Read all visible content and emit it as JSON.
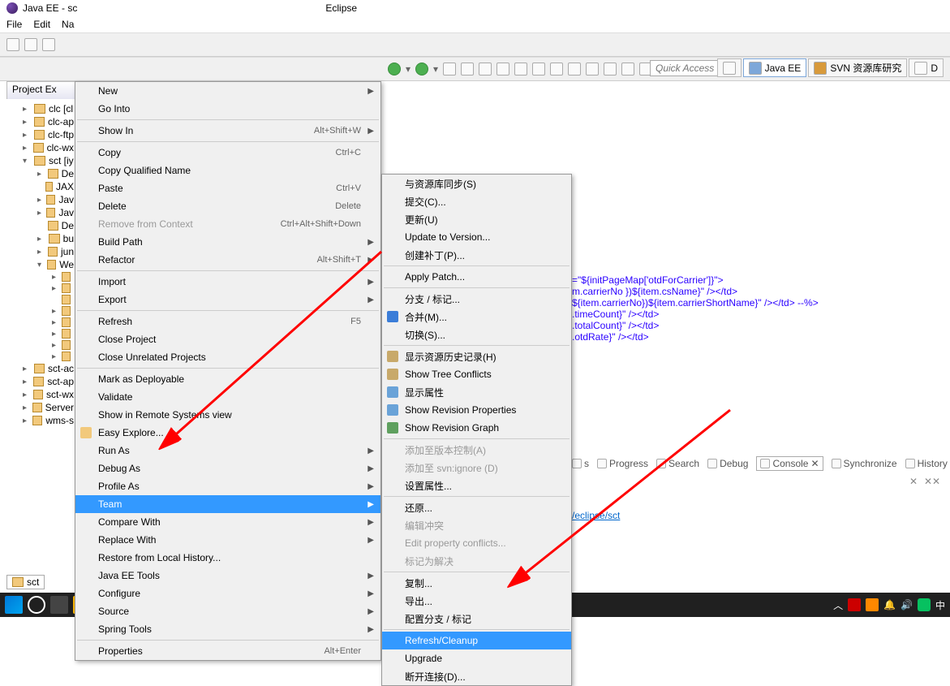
{
  "window_title": "Java EE - sc",
  "partial_end": "Eclipse",
  "menubar": [
    "File",
    "Edit",
    "Na"
  ],
  "quick_access_placeholder": "Quick Access",
  "perspectives": [
    {
      "label": "Java EE",
      "active": true
    },
    {
      "label": "SVN 资源库研究",
      "active": false
    },
    {
      "label": "D",
      "active": false
    }
  ],
  "views": {
    "project_explorer_title": "Project Ex"
  },
  "tree": [
    {
      "label": "clc [cl",
      "level": 1,
      "exp": "▸"
    },
    {
      "label": "clc-ap",
      "level": 1,
      "exp": "▸"
    },
    {
      "label": "clc-ftp",
      "level": 1,
      "exp": "▸"
    },
    {
      "label": "clc-wx",
      "level": 1,
      "exp": "▸"
    },
    {
      "label": "sct [iy",
      "level": 1,
      "exp": "▾",
      "sel": true
    },
    {
      "label": "De",
      "level": 2,
      "exp": "▸"
    },
    {
      "label": "JAX",
      "level": 2,
      "exp": ""
    },
    {
      "label": "Jav",
      "level": 2,
      "exp": "▸"
    },
    {
      "label": "Jav",
      "level": 2,
      "exp": "▸"
    },
    {
      "label": "De",
      "level": 2,
      "exp": ""
    },
    {
      "label": "bu",
      "level": 2,
      "exp": "▸"
    },
    {
      "label": "jun",
      "level": 2,
      "exp": "▸"
    },
    {
      "label": "We",
      "level": 2,
      "exp": "▾"
    },
    {
      "label": "",
      "level": 3,
      "exp": "▸"
    },
    {
      "label": "",
      "level": 3,
      "exp": "▸"
    },
    {
      "label": "",
      "level": 3,
      "exp": ""
    },
    {
      "label": "",
      "level": 3,
      "exp": "▸"
    },
    {
      "label": "",
      "level": 3,
      "exp": "▸"
    },
    {
      "label": "",
      "level": 3,
      "exp": "▸"
    },
    {
      "label": "",
      "level": 3,
      "exp": "▸"
    },
    {
      "label": "",
      "level": 3,
      "exp": "▸"
    },
    {
      "label": "sct-ac",
      "level": 1,
      "exp": "▸"
    },
    {
      "label": "sct-ap",
      "level": 1,
      "exp": "▸"
    },
    {
      "label": "sct-wx",
      "level": 1,
      "exp": "▸"
    },
    {
      "label": "Server",
      "level": 1,
      "exp": "▸"
    },
    {
      "label": "wms-s",
      "level": 1,
      "exp": "▸"
    }
  ],
  "context_menu": [
    {
      "label": "New",
      "arrow": true
    },
    {
      "label": "Go Into"
    },
    {
      "sep": true
    },
    {
      "label": "Show In",
      "shortcut": "Alt+Shift+W",
      "arrow": true
    },
    {
      "sep": true
    },
    {
      "label": "Copy",
      "shortcut": "Ctrl+C"
    },
    {
      "label": "Copy Qualified Name"
    },
    {
      "label": "Paste",
      "shortcut": "Ctrl+V"
    },
    {
      "label": "Delete",
      "shortcut": "Delete"
    },
    {
      "label": "Remove from Context",
      "shortcut": "Ctrl+Alt+Shift+Down",
      "disabled": true
    },
    {
      "label": "Build Path",
      "arrow": true
    },
    {
      "label": "Refactor",
      "shortcut": "Alt+Shift+T",
      "arrow": true
    },
    {
      "sep": true
    },
    {
      "label": "Import",
      "arrow": true
    },
    {
      "label": "Export",
      "arrow": true
    },
    {
      "sep": true
    },
    {
      "label": "Refresh",
      "shortcut": "F5"
    },
    {
      "label": "Close Project"
    },
    {
      "label": "Close Unrelated Projects"
    },
    {
      "sep": true
    },
    {
      "label": "Mark as Deployable"
    },
    {
      "label": "Validate"
    },
    {
      "label": "Show in Remote Systems view"
    },
    {
      "label": "Easy Explore...",
      "icon": "#f2c97c"
    },
    {
      "label": "Run As",
      "arrow": true
    },
    {
      "label": "Debug As",
      "arrow": true
    },
    {
      "label": "Profile As",
      "arrow": true
    },
    {
      "label": "Team",
      "arrow": true,
      "selected": true
    },
    {
      "label": "Compare With",
      "arrow": true
    },
    {
      "label": "Replace With",
      "arrow": true
    },
    {
      "label": "Restore from Local History..."
    },
    {
      "label": "Java EE Tools",
      "arrow": true
    },
    {
      "label": "Configure",
      "arrow": true
    },
    {
      "label": "Source",
      "arrow": true
    },
    {
      "label": "Spring Tools",
      "arrow": true
    },
    {
      "sep": true
    },
    {
      "label": "Properties",
      "shortcut": "Alt+Enter"
    }
  ],
  "team_submenu": [
    {
      "label": "与资源库同步(S)"
    },
    {
      "label": "提交(C)..."
    },
    {
      "label": "更新(U)"
    },
    {
      "label": "Update to Version..."
    },
    {
      "label": "创建补丁(P)..."
    },
    {
      "sep": true
    },
    {
      "label": "Apply Patch..."
    },
    {
      "sep": true
    },
    {
      "label": "分支 / 标记..."
    },
    {
      "label": "合并(M)...",
      "icon": "#3b7dd8"
    },
    {
      "label": "切换(S)..."
    },
    {
      "sep": true
    },
    {
      "label": "显示资源历史记录(H)",
      "icon": "#c8a96a"
    },
    {
      "label": "Show Tree Conflicts",
      "icon": "#c8a96a"
    },
    {
      "label": "显示属性",
      "icon": "#6aa3d8"
    },
    {
      "label": "Show Revision Properties",
      "icon": "#6aa3d8"
    },
    {
      "label": "Show Revision Graph",
      "icon": "#5fa05f"
    },
    {
      "sep": true
    },
    {
      "label": "添加至版本控制(A)",
      "disabled": true
    },
    {
      "label": "添加至 svn:ignore (D)",
      "disabled": true
    },
    {
      "label": "设置属性..."
    },
    {
      "sep": true
    },
    {
      "label": "还原..."
    },
    {
      "label": "编辑冲突",
      "disabled": true
    },
    {
      "label": "Edit property conflicts...",
      "disabled": true
    },
    {
      "label": "标记为解决",
      "disabled": true
    },
    {
      "sep": true
    },
    {
      "label": "复制..."
    },
    {
      "label": "导出..."
    },
    {
      "label": "配置分支 / 标记"
    },
    {
      "sep": true
    },
    {
      "label": "Refresh/Cleanup",
      "selected": true
    },
    {
      "label": "Upgrade"
    },
    {
      "label": "断开连接(D)..."
    }
  ],
  "editor_lines": [
    "=\"${initPageMap['otdForCarrier']}\">",
    "",
    "m.carrierNo })${item.csName}\" /></td>",
    "${item.carrierNo})${item.carrierShortName}\" /></td> --%>",
    ".timeCount}\" /></td>",
    ".totalCount}\" /></td>",
    ".otdRate}\" /></td>"
  ],
  "console_tabs": [
    "s",
    "Progress",
    "Search",
    "Debug",
    "Console",
    "Synchronize",
    "History"
  ],
  "console_active": 4,
  "console_link": "/eclipse/sct",
  "bottom_tab": "sct"
}
